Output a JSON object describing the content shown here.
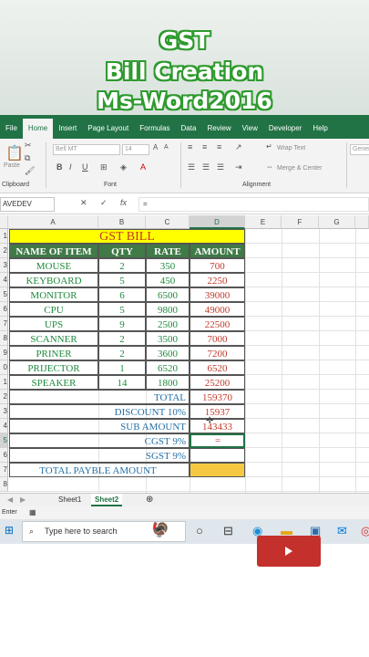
{
  "video_title": {
    "line1": "GST",
    "line2": "Bill Creation",
    "line3": "Ms-Word2016"
  },
  "ribbon": {
    "tabs": [
      "File",
      "Home",
      "Insert",
      "Page Layout",
      "Formulas",
      "Data",
      "Review",
      "View",
      "Developer",
      "Help"
    ],
    "active_tab": "Home",
    "paste_label": "Paste",
    "font_name": "Bell MT",
    "font_size": "14",
    "wrap_text": "Wrap Text",
    "merge_center": "Merge & Center",
    "number_format": "Gener",
    "groups": {
      "clipboard": "Clipboard",
      "font": "Font",
      "alignment": "Alignment"
    }
  },
  "formula_bar": {
    "name_box": "AVEDEV",
    "cancel": "✕",
    "confirm": "✓",
    "fx": "fx",
    "content": "="
  },
  "sheet": {
    "columns": [
      "A",
      "B",
      "C",
      "D",
      "E",
      "F",
      "G"
    ],
    "rows": [
      "1",
      "2",
      "3",
      "4",
      "5",
      "6",
      "7",
      "8",
      "9",
      "0",
      "1",
      "2",
      "3",
      "4",
      "5",
      "6",
      "7",
      "8"
    ],
    "title": "GST BILL",
    "headers": [
      "NAME OF ITEM",
      "QTY",
      "RATE",
      "AMOUNT"
    ],
    "items": [
      {
        "name": "MOUSE",
        "qty": "2",
        "rate": "350",
        "amount": "700"
      },
      {
        "name": "KEYBOARD",
        "qty": "5",
        "rate": "450",
        "amount": "2250"
      },
      {
        "name": "MONITOR",
        "qty": "6",
        "rate": "6500",
        "amount": "39000"
      },
      {
        "name": "CPU",
        "qty": "5",
        "rate": "9800",
        "amount": "49000"
      },
      {
        "name": "UPS",
        "qty": "9",
        "rate": "2500",
        "amount": "22500"
      },
      {
        "name": "SCANNER",
        "qty": "2",
        "rate": "3500",
        "amount": "7000"
      },
      {
        "name": "PRINER",
        "qty": "2",
        "rate": "3600",
        "amount": "7200"
      },
      {
        "name": "PRIJECTOR",
        "qty": "1",
        "rate": "6520",
        "amount": "6520"
      },
      {
        "name": "SPEAKER",
        "qty": "14",
        "rate": "1800",
        "amount": "25200"
      }
    ],
    "total_label": "TOTAL",
    "total_value": "159370",
    "discount_label": "DISCOUNT 10%",
    "discount_value": "15937",
    "subamount_label": "SUB AMOUNT",
    "subamount_value": "143433",
    "cgst_label": "CGST 9%",
    "cgst_value": "=",
    "sgst_label": "SGST 9%",
    "payable_label": "TOTAL PAYBLE AMOUNT"
  },
  "sheet_tabs": [
    "Sheet1",
    "Sheet2"
  ],
  "active_sheet": "Sheet2",
  "status": "Enter",
  "taskbar": {
    "search_placeholder": "Type here to search"
  },
  "colors": {
    "excel_green": "#217346",
    "header_fill": "#3f7a47",
    "title_fill": "#ffff00",
    "item_text": "#1f8a3e",
    "amount_text": "#c0392b",
    "summary_text": "#2570a8",
    "payable_fill": "#f5c842"
  }
}
